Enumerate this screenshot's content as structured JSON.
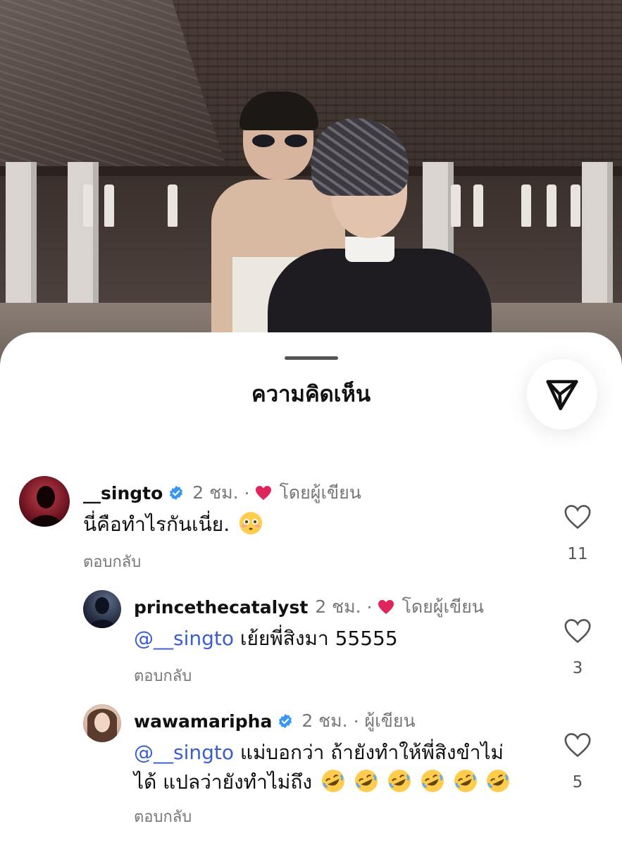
{
  "sheet": {
    "title": "ความคิดเห็น"
  },
  "icons": {
    "share": "paper-plane-icon",
    "verified": "verified-badge-icon",
    "author_like": "red-heart-icon",
    "like": "heart-outline-icon"
  },
  "colors": {
    "mention": "#3a5fcd",
    "verified": "#3897f0",
    "author_heart": "#e0245e"
  },
  "comments": [
    {
      "username": "__singto",
      "time": "2 ชม.",
      "author_tag": "โดยผู้เขียน",
      "text": "นี่คือทำไรกันเนี่ย.",
      "emoji": "flushed-face",
      "reply_label": "ตอบกลับ",
      "likes": "11"
    },
    {
      "username": "princethecatalyst",
      "time": "2 ชม.",
      "author_tag": "โดยผู้เขียน",
      "mention": "@__singto",
      "text": "เย้ยพี่สิงมา 55555",
      "reply_label": "ตอบกลับ",
      "likes": "3"
    },
    {
      "username": "wawamaripha",
      "time": "2 ชม.",
      "author_tag": "ผู้เขียน",
      "mention": "@__singto",
      "text_line1": "แม่บอกว่า ถ้ายังทำให้พี่สิงขำไม่",
      "text_line2": "ได้ แปลว่ายังทำไม่ถึง",
      "emoji": "rolling-on-floor-laughing",
      "reply_label": "ตอบกลับ",
      "likes": "5"
    }
  ]
}
